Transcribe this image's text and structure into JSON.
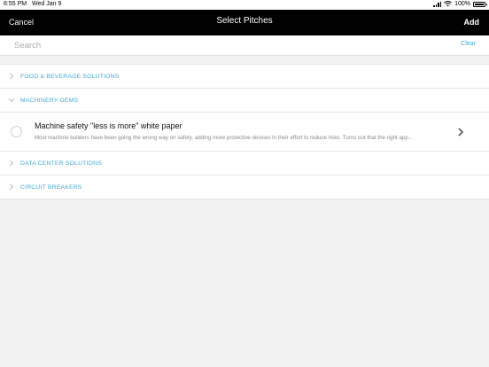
{
  "status_bar": {
    "time": "6:55 PM",
    "date": "Wed Jan 9",
    "battery": "100%",
    "battery_level": 1.0
  },
  "navbar": {
    "cancel_label": "Cancel",
    "title": "Select Pitches",
    "add_label": "Add"
  },
  "search": {
    "placeholder": "Search",
    "value": "",
    "clear_label": "Clear"
  },
  "categories": [
    {
      "label": "FOOD & BEVERAGE SOLUTIONS",
      "expanded": false,
      "icon": "chevron-right-icon"
    },
    {
      "label": "MACHINERY OEMS",
      "expanded": true,
      "icon": "chevron-down-icon"
    },
    {
      "label": "DATA CENTER SOLUTIONS",
      "expanded": false,
      "icon": "chevron-right-icon"
    },
    {
      "label": "CIRCUIT BREAKERS",
      "expanded": false,
      "icon": "chevron-right-icon"
    }
  ],
  "pitches": [
    {
      "title": "Machine safety \"less is more\" white paper",
      "description": "Most machine builders have been going the wrong way on safety, adding more protective devices in their effort to reduce risks. Turns out that the right app...",
      "selected": false
    }
  ],
  "colors": {
    "accent": "#45a9d9",
    "navbar_bg": "#000000",
    "page_bg": "#f2f2f2"
  }
}
